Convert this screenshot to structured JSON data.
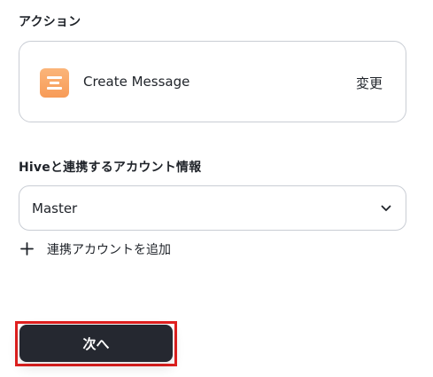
{
  "action_section": {
    "label": "アクション",
    "action_name": "Create Message",
    "change_label": "変更",
    "icon": "hive-message-icon",
    "icon_color": "#F79B57"
  },
  "account_section": {
    "label": "Hiveと連携するアカウント情報",
    "selected_account": "Master",
    "add_account_label": "連携アカウントを追加"
  },
  "footer": {
    "next_label": "次へ",
    "button_color": "#252830",
    "highlight_color": "#E0201F"
  }
}
